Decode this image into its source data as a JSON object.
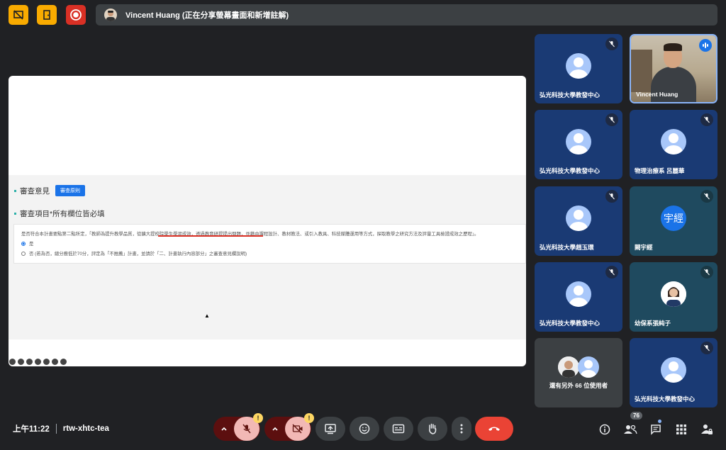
{
  "top_bar": {
    "presenter_text": "Vincent Huang (正在分享螢幕畫面和新增註解)",
    "colors": {
      "yellow": "#f9ab00",
      "red": "#d93025"
    },
    "icons": [
      "stop-screenshare-icon",
      "leave-presentation-icon",
      "recording-icon"
    ]
  },
  "shared_screen": {
    "section1_title": "審查意見",
    "section1_button": "審查原則",
    "section2_title": "審查項目*所有欄位皆必填",
    "question": "是否符合本計畫要點第二點所定，「教師為提升教學品質，從擴大提校院學生學習成效，透過教育研提提出問題，並藉由課程設計、教材教法、或引入教具、科技媒體運用等方式，探取教學之研究方法及評量工具檢證成效之歷程」。",
    "option_yes": "是",
    "option_no": "否 (若為否，總分應低於70分，評定為「不推薦」計畫，並請於「二、計畫執行內容部分」之審查意見欄說明)"
  },
  "participants": [
    {
      "name": "弘光科技大學教發中心",
      "kind": "generic",
      "muted": true
    },
    {
      "name": "Vincent Huang",
      "kind": "video",
      "speaking": true
    },
    {
      "name": "弘光科技大學教發中心",
      "kind": "generic",
      "muted": true
    },
    {
      "name": "物理治療系 呂麗華",
      "kind": "generic",
      "muted": true
    },
    {
      "name": "弘光科技大學趙玉環",
      "kind": "generic",
      "muted": true
    },
    {
      "name": "闕宇經",
      "kind": "letter",
      "letter": "宇經",
      "muted": true
    },
    {
      "name": "弘光科技大學教發中心",
      "kind": "generic",
      "muted": true
    },
    {
      "name": "幼保系張純子",
      "kind": "photo",
      "muted": true
    },
    {
      "name": "還有另外 66 位使用者",
      "kind": "others"
    },
    {
      "name": "弘光科技大學教發中心",
      "kind": "generic",
      "muted": true
    }
  ],
  "bottom_bar": {
    "time": "上午11:22",
    "meeting_code": "rtw-xhtc-tea",
    "warning_badge": "!",
    "people_count": "76"
  }
}
